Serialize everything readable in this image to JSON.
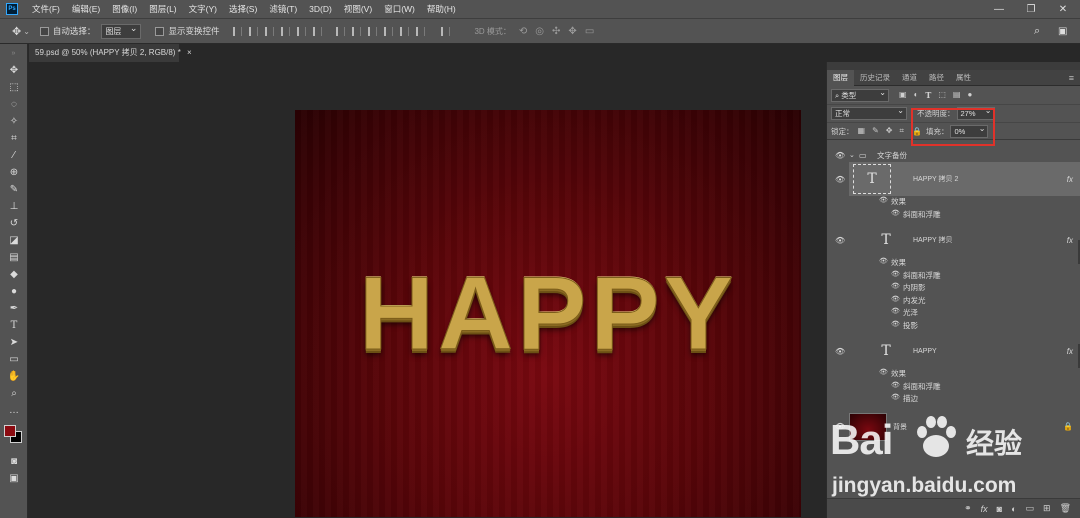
{
  "app": {
    "logo": "Ps",
    "menu": [
      "文件(F)",
      "编辑(E)",
      "图像(I)",
      "图层(L)",
      "文字(Y)",
      "选择(S)",
      "滤镜(T)",
      "3D(D)",
      "视图(V)",
      "窗口(W)",
      "帮助(H)"
    ],
    "window_controls": {
      "minimize": "—",
      "restore": "❐",
      "close": "✕"
    }
  },
  "options_bar": {
    "auto_select_label": "自动选择：",
    "auto_select_value": "图层",
    "show_transform_label": "显示变换控件",
    "mode3d_label": "3D 模式："
  },
  "document": {
    "tab_title": "59.psd @ 50% (HAPPY 拷贝 2, RGB/8) *",
    "tab_close": "×",
    "canvas_text": "HAPPY"
  },
  "panel": {
    "tabs": [
      "图层",
      "历史记录",
      "通道",
      "路径",
      "属性"
    ],
    "active_tab": "图层",
    "filter_kind": "类型",
    "blend_mode": "正常",
    "opacity_label": "不透明度：",
    "opacity_value": "27%",
    "lock_label": "锁定：",
    "fill_label": "填充：",
    "fill_value": "0%",
    "group_name": "文字备份",
    "layers": [
      {
        "name": "HAPPY 拷贝 2",
        "fx": "fx",
        "effects_label": "效果",
        "effects": [
          "斜面和浮雕"
        ]
      },
      {
        "name": "HAPPY 拷贝",
        "fx": "fx",
        "effects_label": "效果",
        "effects": [
          "斜面和浮雕",
          "内阴影",
          "内发光",
          "光泽",
          "投影"
        ]
      },
      {
        "name": "HAPPY",
        "fx": "fx",
        "effects_label": "效果",
        "effects": [
          "斜面和浮雕",
          "描边"
        ]
      }
    ],
    "background_layer": "背景"
  },
  "watermark": {
    "brand": "Bai",
    "brand_tail": "经验",
    "url": "jingyan.baidu.com"
  },
  "colors": {
    "foreground": "#8b0a10",
    "background": "#000000",
    "highlight": "#e0322a"
  }
}
